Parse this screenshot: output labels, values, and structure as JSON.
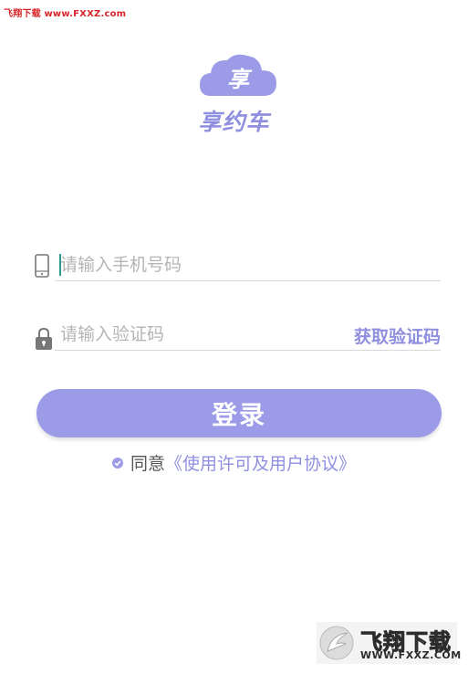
{
  "watermark_top": "飞翔下载 www.FXXZ.com",
  "logo": {
    "badge_char": "享",
    "name": "享约车"
  },
  "phone_input": {
    "placeholder": "请输入手机号码",
    "icon": "phone-icon"
  },
  "code_input": {
    "placeholder": "请输入验证码",
    "icon": "lock-icon"
  },
  "get_code_label": "获取验证码",
  "login_label": "登录",
  "agreement": {
    "prefix": "同意",
    "link": "《使用许可及用户协议》"
  },
  "watermark_br": {
    "name": "飞翔下载",
    "url": "WWW.FXXZ.COM"
  },
  "colors": {
    "accent": "#9b9be8",
    "accent_text": "#8f8fe0",
    "caret": "#2c9a92",
    "watermark_red": "#d9262b"
  }
}
